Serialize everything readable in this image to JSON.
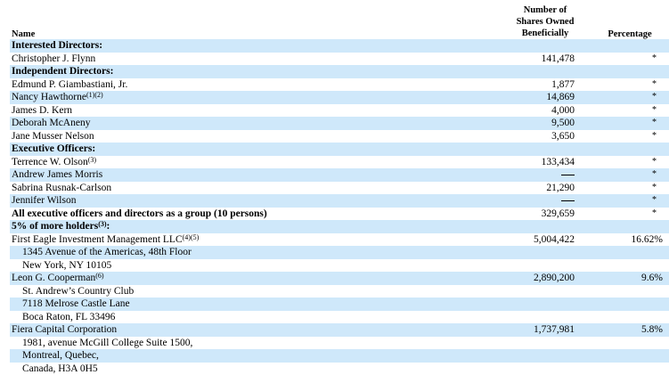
{
  "headers": {
    "name": "Name",
    "shares_line1": "Number of",
    "shares_line2": "Shares Owned",
    "shares_line3": "Beneficially",
    "percentage": "Percentage"
  },
  "rows": [
    {
      "type": "section",
      "name": "Interested Directors:"
    },
    {
      "name": "Christopher J. Flynn",
      "note": "",
      "shares": "141,478",
      "pct": "*"
    },
    {
      "type": "section",
      "name": "Independent Directors:"
    },
    {
      "name": "Edmund P. Giambastiani, Jr.",
      "note": "",
      "shares": "1,877",
      "pct": "*"
    },
    {
      "name": "Nancy Hawthorne",
      "note": "(1)(2)",
      "shares": "14,869",
      "pct": "*"
    },
    {
      "name": "James D. Kern",
      "note": "",
      "shares": "4,000",
      "pct": "*"
    },
    {
      "name": "Deborah McAneny",
      "note": "",
      "shares": "9,500",
      "pct": "*"
    },
    {
      "name": "Jane Musser Nelson",
      "note": "",
      "shares": "3,650",
      "pct": "*"
    },
    {
      "type": "section",
      "name": "Executive Officers:"
    },
    {
      "name": "Terrence W. Olson",
      "note": "(3)",
      "shares": "133,434",
      "pct": "*"
    },
    {
      "name": "Andrew James Morris",
      "note": "",
      "shares": "—",
      "pct": "*"
    },
    {
      "name": "Sabrina Rusnak-Carlson",
      "note": "",
      "shares": "21,290",
      "pct": "*"
    },
    {
      "name": "Jennifer Wilson",
      "note": "",
      "shares": "—",
      "pct": "*"
    },
    {
      "type": "total",
      "name": "All executive officers and directors as a group (10 persons)",
      "shares": "329,659",
      "pct": "*"
    },
    {
      "type": "section",
      "name": "5% of more holders",
      "note": "(3)",
      "suffix": ":"
    },
    {
      "name": "First Eagle Investment Management LLC",
      "note": "(4)(5)",
      "shares": "5,004,422",
      "pct": "16.62%"
    },
    {
      "type": "addr",
      "name": "1345 Avenue of the Americas, 48th Floor"
    },
    {
      "type": "addr",
      "name": "New York, NY 10105"
    },
    {
      "name": "Leon G. Cooperman",
      "note": "(6)",
      "shares": "2,890,200",
      "pct": "9.6%"
    },
    {
      "type": "addr",
      "name": "St. Andrew’s Country Club"
    },
    {
      "type": "addr",
      "name": "7118 Melrose Castle Lane"
    },
    {
      "type": "addr",
      "name": "Boca Raton, FL 33496"
    },
    {
      "name": "Fiera Capital Corporation",
      "note": "",
      "shares": "1,737,981",
      "pct": "5.8%"
    },
    {
      "type": "addr",
      "name": "1981, avenue McGill College Suite 1500,"
    },
    {
      "type": "addr",
      "name": "Montreal, Quebec,"
    },
    {
      "type": "addr",
      "name": "Canada, H3A 0H5"
    }
  ]
}
